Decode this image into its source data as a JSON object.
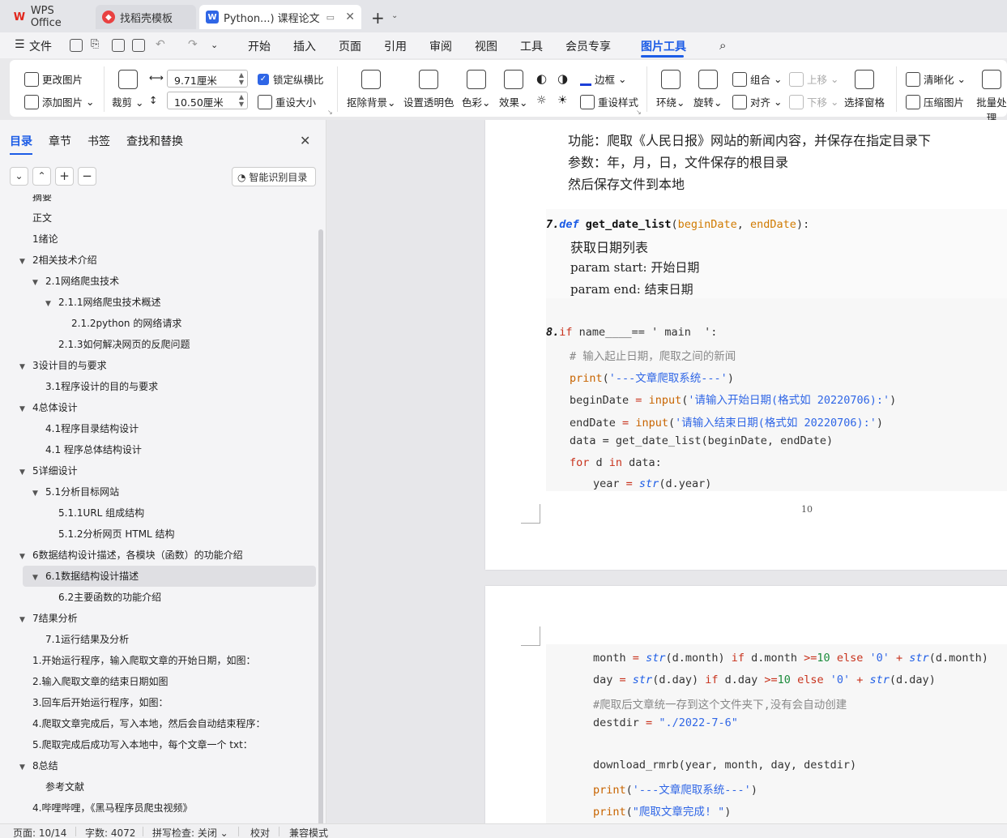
{
  "tabs": [
    {
      "label": "WPS Office"
    },
    {
      "label": "找稻壳模板"
    },
    {
      "label": "Python...)  课程论文"
    }
  ],
  "menu": {
    "file": "文件",
    "items": [
      "开始",
      "插入",
      "页面",
      "引用",
      "审阅",
      "视图",
      "工具",
      "会员专享",
      "图片工具"
    ],
    "active": "图片工具"
  },
  "ribbon": {
    "change_picture": "更改图片",
    "add_picture": "添加图片",
    "crop": "裁剪",
    "width_value": "9.71厘米",
    "height_value": "10.50厘米",
    "lock_ratio": "锁定纵横比",
    "reset_size": "重设大小",
    "remove_bg": "抠除背景",
    "set_transparent": "设置透明色",
    "color": "色彩",
    "effects": "效果",
    "border": "边框",
    "reset_style": "重设样式",
    "wrap": "环绕",
    "rotate": "旋转",
    "group": "组合",
    "align": "对齐",
    "bring_up": "上移",
    "send_down": "下移",
    "select_pane": "选择窗格",
    "sharpen": "清晰化",
    "compress": "压缩图片",
    "batch": "批量处理"
  },
  "nav": {
    "tabs": [
      "目录",
      "章节",
      "书签",
      "查找和替换"
    ],
    "ai_toc": "智能识别目录",
    "toc": [
      {
        "label": "摘要",
        "level": 1,
        "arrow": ""
      },
      {
        "label": "正文",
        "level": 1,
        "arrow": ""
      },
      {
        "label": "1绪论",
        "level": 1,
        "arrow": ""
      },
      {
        "label": "2相关技术介绍",
        "level": 1,
        "arrow": "▼"
      },
      {
        "label": "2.1网络爬虫技术",
        "level": 2,
        "arrow": "▼"
      },
      {
        "label": "2.1.1网络爬虫技术概述",
        "level": 3,
        "arrow": "▼"
      },
      {
        "label": "2.1.2python 的网络请求",
        "level": 4,
        "arrow": ""
      },
      {
        "label": "2.1.3如何解决网页的反爬问题",
        "level": 3,
        "arrow": ""
      },
      {
        "label": "3设计目的与要求",
        "level": 1,
        "arrow": "▼"
      },
      {
        "label": "3.1程序设计的目的与要求",
        "level": 2,
        "arrow": ""
      },
      {
        "label": "4总体设计",
        "level": 1,
        "arrow": "▼"
      },
      {
        "label": "4.1程序目录结构设计",
        "level": 2,
        "arrow": ""
      },
      {
        "label": "4.1 程序总体结构设计",
        "level": 2,
        "arrow": ""
      },
      {
        "label": "5详细设计",
        "level": 1,
        "arrow": "▼"
      },
      {
        "label": "5.1分析目标网站",
        "level": 2,
        "arrow": "▼"
      },
      {
        "label": "5.1.1URL 组成结构",
        "level": 3,
        "arrow": ""
      },
      {
        "label": "5.1.2分析网页 HTML 结构",
        "level": 3,
        "arrow": ""
      },
      {
        "label": "6数据结构设计描述，各模块（函数）的功能介绍",
        "level": 1,
        "arrow": "▼"
      },
      {
        "label": "6.1数据结构设计描述",
        "level": 2,
        "arrow": "▼",
        "selected": true
      },
      {
        "label": "6.2主要函数的功能介绍",
        "level": 3,
        "arrow": ""
      },
      {
        "label": "7结果分析",
        "level": 1,
        "arrow": "▼"
      },
      {
        "label": "7.1运行结果及分析",
        "level": 2,
        "arrow": ""
      },
      {
        "label": "1.开始运行程序，输入爬取文章的开始日期，如图：",
        "level": 1,
        "arrow": ""
      },
      {
        "label": "2.输入爬取文章的结束日期如图",
        "level": 1,
        "arrow": ""
      },
      {
        "label": "3.回车后开始运行程序，如图：",
        "level": 1,
        "arrow": ""
      },
      {
        "label": "4.爬取文章完成后，写入本地，然后会自动结束程序：",
        "level": 1,
        "arrow": ""
      },
      {
        "label": "5.爬取完成后成功写入本地中，每个文章一个 txt：",
        "level": 1,
        "arrow": ""
      },
      {
        "label": "8总结",
        "level": 1,
        "arrow": "▼"
      },
      {
        "label": "参考文献",
        "level": 2,
        "arrow": ""
      },
      {
        "label": "4.哔哩哔哩，《黑马程序员爬虫视频》",
        "level": 1,
        "arrow": ""
      }
    ]
  },
  "doc": {
    "p1_desc": [
      "功能：爬取《人民日报》网站的新闻内容，并保存在指定目录下",
      "参数：年，月，日，文件保存的根目录",
      "然后保存文件到本地"
    ],
    "def_num": "7.",
    "def_kw": "def",
    "def_name": "get_date_list",
    "def_p1": "beginDate",
    "def_p2": "endDate",
    "doc_lines": [
      "获取日期列表",
      "param start: 开始日期",
      "param end: 结束日期"
    ],
    "if_num": "8.",
    "if_line_rest": " name____== ' main  ':",
    "comment1": "# 输入起止日期，爬取之间的新闻",
    "print1": "'---文章爬取系统---'",
    "begin_prompt": "'请输入开始日期(格式如 20220706):'",
    "end_prompt": "'请输入结束日期(格式如 20220706):'",
    "data_line": "data = get_date_list(beginDate, endDate)",
    "for_line": "for d in data:",
    "year_line": "year = str(d.year)",
    "page_number": "10",
    "month_line": "month = str(d.month) if d.month >=10 else '0' + str(d.month)",
    "day_line": "day = str(d.day) if d.day >=10 else '0' + str(d.day)",
    "comment2": "#爬取后文章统一存到这个文件夹下,没有会自动创建",
    "destdir": "\"./2022-7-6\"",
    "download_line": "download_rmrb(year, month, day, destdir)",
    "print2": "'---文章爬取系统---'",
    "print3": "\"爬取文章完成! \""
  },
  "status": {
    "page": "页面: 10/14",
    "words": "字数: 4072",
    "spell": "拼写检查: 关闭",
    "proof": "校对",
    "compat": "兼容模式"
  },
  "colors": {
    "accent": "#1c5ce6",
    "keyword": "#c8331d",
    "string": "#2f66e6"
  }
}
